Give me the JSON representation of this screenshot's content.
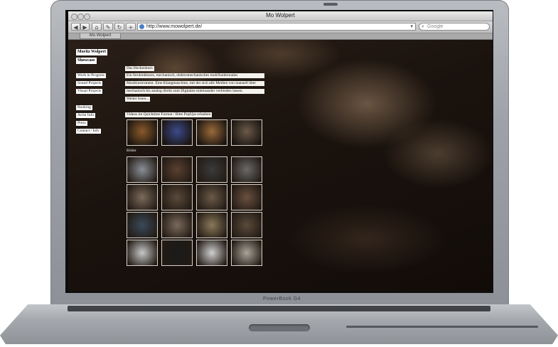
{
  "laptop": {
    "brand_label": "PowerBook G4"
  },
  "window": {
    "title": "Mo Wolpert"
  },
  "toolbar": {
    "back_label": "◀",
    "forward_label": "▶",
    "home_label": "⌂",
    "bookmark_label": "✎",
    "reload_label": "↻",
    "add_label": "+",
    "url": "http://www.mowolpert.de/",
    "search_placeholder": "Google"
  },
  "tabs": [
    {
      "label": "Mo Wolpert"
    }
  ],
  "site": {
    "name_line1": "Moritz Wolpert",
    "name_line2": "Showcase",
    "nav": [
      "Work in Progress",
      "Sound Projects",
      "Visual Projects",
      "Booking",
      "Artist Info",
      "Press",
      "Contact / Info"
    ],
    "article": {
      "heading": "Das Heckenhorn",
      "lines": [
        "Ein fernlenkbares, mechanisch, elektromechanisches multifunktionales",
        "Musikinstrument. Eine Klangmaschine, mit der sich alle Medien von manuell über",
        "mechanisch bis analog direkt zum Digitalen miteinander verbinden lassen.",
        "Weiter lesen..."
      ]
    },
    "videos_label": "Videos im Quicktime Format / Bitte PopUps erlauben",
    "bilder_label": "Bilder",
    "video_thumbs": [
      "#8a5a2a",
      "#3b4a8a",
      "#9a6a3a",
      "#6a5a4a"
    ],
    "image_thumbs": [
      "#8a8f96",
      "#5a4030",
      "#3a3a3a",
      "#6a6a6a",
      "#7a6a5a",
      "#5a4a3a",
      "#6a5a48",
      "#6a5040",
      "#3a4a5a",
      "#7a6a5a",
      "#8a7a5a",
      "#5a4a3a",
      "#c8c8c8",
      "#1a1a1a",
      "#d0d0d0",
      "#aaa49a"
    ]
  }
}
